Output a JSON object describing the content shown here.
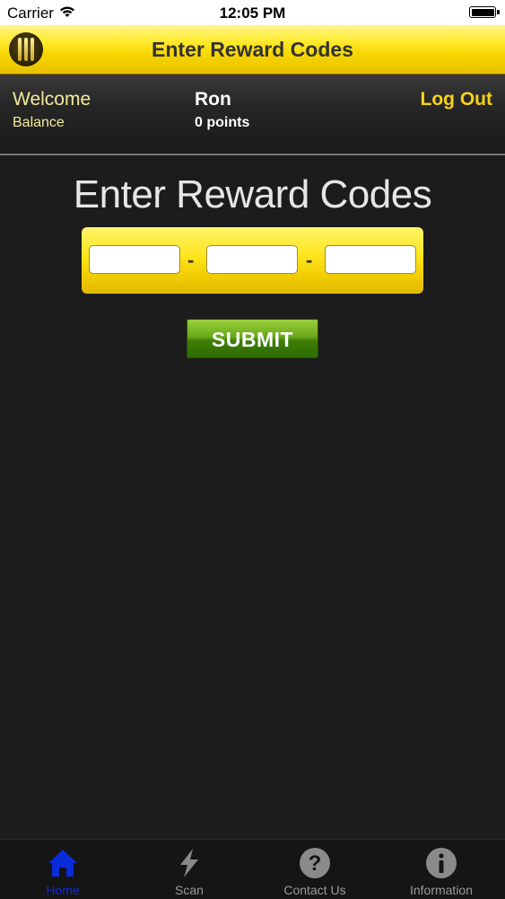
{
  "status_bar": {
    "carrier": "Carrier",
    "time": "12:05 PM"
  },
  "nav": {
    "title": "Enter Reward Codes",
    "logo_icon": "logo-icon"
  },
  "user": {
    "welcome_label": "Welcome",
    "balance_label": "Balance",
    "name": "Ron",
    "points": "0 points",
    "logout_label": "Log Out"
  },
  "main": {
    "heading": "Enter Reward Codes",
    "code_fields": [
      {
        "value": "",
        "placeholder": ""
      },
      {
        "value": "",
        "placeholder": ""
      },
      {
        "value": "",
        "placeholder": ""
      }
    ],
    "separator": "-",
    "submit_label": "SUBMIT"
  },
  "tabs": [
    {
      "label": "Home",
      "icon": "home-icon",
      "active": true
    },
    {
      "label": "Scan",
      "icon": "lightning-icon",
      "active": false
    },
    {
      "label": "Contact Us",
      "icon": "question-icon",
      "active": false
    },
    {
      "label": "Information",
      "icon": "info-icon",
      "active": false
    }
  ],
  "colors": {
    "accent_yellow": "#f8d21a",
    "submit_green": "#4a8a0a",
    "active_tab": "#0a2bd8",
    "background": "#1c1c1c"
  }
}
